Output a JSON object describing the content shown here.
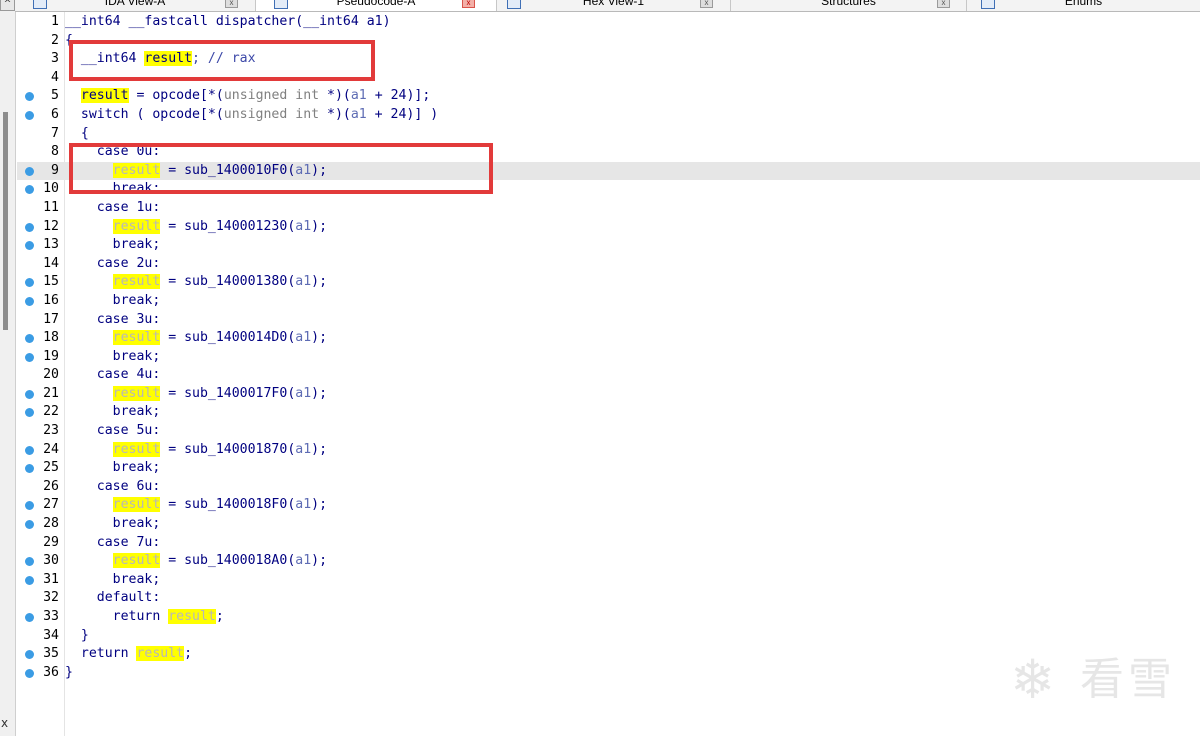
{
  "tabs": [
    {
      "label": "IDA View-A",
      "close": "x"
    },
    {
      "label": "Pseudocode-A",
      "close": "x"
    },
    {
      "label": "Hex View-1",
      "close": "x"
    },
    {
      "label": "Structures",
      "close": "x"
    },
    {
      "label": "Enums",
      "close": ""
    }
  ],
  "left_strip": {
    "top_glyph": "^",
    "bottom_glyph": "x"
  },
  "code": {
    "l1": {
      "n": "1",
      "t": "__int64 __fastcall dispatcher(__int64 a1)"
    },
    "l2": {
      "n": "2",
      "t": "{"
    },
    "l3": {
      "n": "3",
      "a": "  __int64 ",
      "v": "result",
      "b": "; // rax"
    },
    "l4": {
      "n": "4"
    },
    "l5": {
      "n": "5",
      "v": "result",
      "a": " = opcode[*(",
      "typ": "unsigned int",
      "b": " *)(",
      "arg": "a1",
      "c": " + 24)];"
    },
    "l6": {
      "n": "6",
      "a": "  switch ( opcode[*(",
      "typ": "unsigned int",
      "b": " *)(",
      "arg": "a1",
      "c": " + 24)] )"
    },
    "l7": {
      "n": "7",
      "t": "  {"
    },
    "l8": {
      "n": "8",
      "t": "    case 0u:"
    },
    "l9": {
      "n": "9",
      "v": "result",
      "a": " = sub_1400010F0(",
      "arg": "a1",
      "b": ");"
    },
    "l10": {
      "n": "10",
      "t": "      break;"
    },
    "l11": {
      "n": "11",
      "t": "    case 1u:"
    },
    "l12": {
      "n": "12",
      "v": "result",
      "a": " = sub_140001230(",
      "arg": "a1",
      "b": ");"
    },
    "l13": {
      "n": "13",
      "t": "      break;"
    },
    "l14": {
      "n": "14",
      "t": "    case 2u:"
    },
    "l15": {
      "n": "15",
      "v": "result",
      "a": " = sub_140001380(",
      "arg": "a1",
      "b": ");"
    },
    "l16": {
      "n": "16",
      "t": "      break;"
    },
    "l17": {
      "n": "17",
      "t": "    case 3u:"
    },
    "l18": {
      "n": "18",
      "v": "result",
      "a": " = sub_1400014D0(",
      "arg": "a1",
      "b": ");"
    },
    "l19": {
      "n": "19",
      "t": "      break;"
    },
    "l20": {
      "n": "20",
      "t": "    case 4u:"
    },
    "l21": {
      "n": "21",
      "v": "result",
      "a": " = sub_1400017F0(",
      "arg": "a1",
      "b": ");"
    },
    "l22": {
      "n": "22",
      "t": "      break;"
    },
    "l23": {
      "n": "23",
      "t": "    case 5u:"
    },
    "l24": {
      "n": "24",
      "v": "result",
      "a": " = sub_140001870(",
      "arg": "a1",
      "b": ");"
    },
    "l25": {
      "n": "25",
      "t": "      break;"
    },
    "l26": {
      "n": "26",
      "t": "    case 6u:"
    },
    "l27": {
      "n": "27",
      "v": "result",
      "a": " = sub_1400018F0(",
      "arg": "a1",
      "b": ");"
    },
    "l28": {
      "n": "28",
      "t": "      break;"
    },
    "l29": {
      "n": "29",
      "t": "    case 7u:"
    },
    "l30": {
      "n": "30",
      "v": "result",
      "a": " = sub_1400018A0(",
      "arg": "a1",
      "b": ");"
    },
    "l31": {
      "n": "31",
      "t": "      break;"
    },
    "l32": {
      "n": "32",
      "t": "    default:"
    },
    "l33": {
      "n": "33",
      "a": "      return ",
      "v": "result",
      "b": ";"
    },
    "l34": {
      "n": "34",
      "t": "  }"
    },
    "l35": {
      "n": "35",
      "a": "  return ",
      "v": "result",
      "b": ";"
    },
    "l36": {
      "n": "36",
      "t": "}"
    }
  },
  "watermark": {
    "text": "看雪",
    "icon": "snowflake-icon"
  },
  "colors": {
    "highlight": "#ffff00",
    "annotation_box": "#e23a3a",
    "breakpoint_dot": "#3b9ce4",
    "code_text": "#000080"
  }
}
